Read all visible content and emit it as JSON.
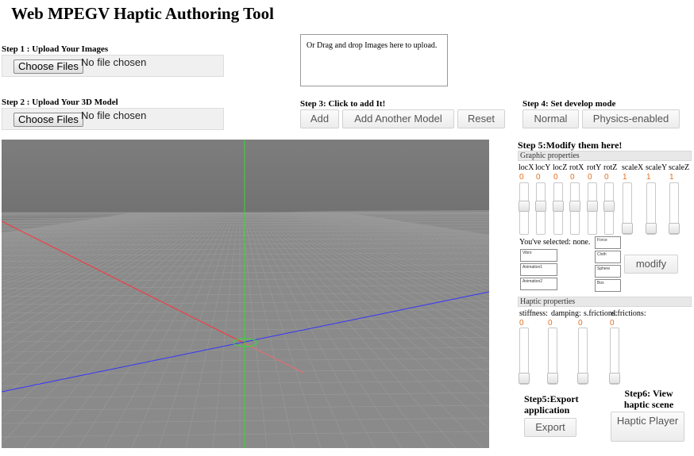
{
  "title": "Web MPEGV Haptic Authoring Tool",
  "step1": {
    "label": "Step 1 : Upload Your Images",
    "choose": "Choose Files",
    "status": "No file chosen"
  },
  "step2": {
    "label": "Step 2 : Upload Your 3D Model",
    "choose": "Choose Files",
    "status": "No file chosen"
  },
  "dropzone": {
    "text": "Or Drag and drop Images here to upload."
  },
  "step3": {
    "label": "Step 3: Click to add It!",
    "add": "Add",
    "add_another": "Add Another Model",
    "reset": "Reset"
  },
  "step4": {
    "label": "Step 4: Set develop mode",
    "normal": "Normal",
    "physics": "Physics-enabled"
  },
  "step5": {
    "label": "Step 5:Modify them here!",
    "graphic_header": "Graphic properties",
    "graphic_sliders": [
      {
        "label": "locX",
        "value": "0"
      },
      {
        "label": "locY",
        "value": "0"
      },
      {
        "label": "locZ",
        "value": "0"
      },
      {
        "label": "rotX",
        "value": "0"
      },
      {
        "label": "rotY",
        "value": "0"
      },
      {
        "label": "rotZ",
        "value": "0"
      },
      {
        "label": "scaleX",
        "value": "1"
      },
      {
        "label": "scaleY",
        "value": "1"
      },
      {
        "label": "scaleZ",
        "value": "1"
      }
    ],
    "selected_text": "You've selected: none.",
    "left_fields": [
      "Vibro",
      "Animation1",
      "Animation2"
    ],
    "right_fields": [
      "Force",
      "Cloth",
      "Sphere",
      "Box"
    ],
    "modify": "modify",
    "haptic_header": "Haptic properties",
    "haptic_sliders": [
      {
        "label": "stiffness:",
        "value": "0"
      },
      {
        "label": "damping:",
        "value": "0"
      },
      {
        "label": "s.frictions:",
        "value": "0"
      },
      {
        "label": "d.frictions:",
        "value": "0"
      }
    ]
  },
  "export": {
    "label": "Step5:Export application",
    "button": "Export"
  },
  "step6": {
    "label": "Step6: View haptic scene",
    "button": "Haptic Player"
  },
  "colors": {
    "viewport_bg": "#808080",
    "x_axis": "#ff3333",
    "y_axis": "#33dd33",
    "z_axis": "#3333ff",
    "value_text": "#e07020"
  }
}
